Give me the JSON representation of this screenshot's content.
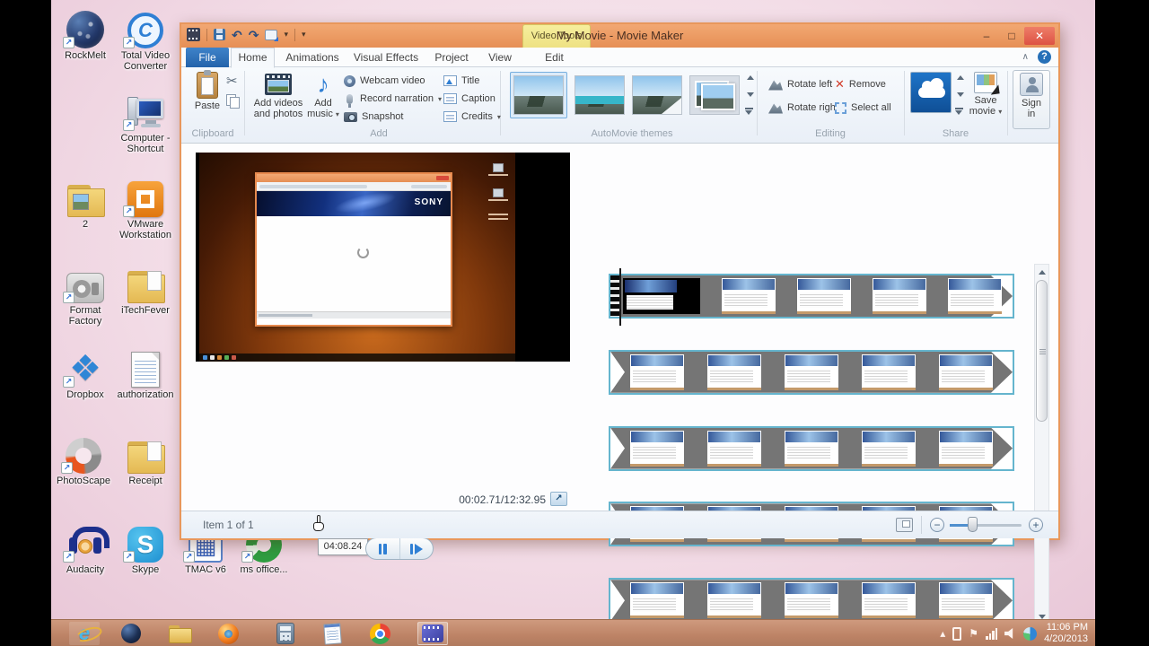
{
  "glyphs": {
    "minimize": "–",
    "maximize": "□",
    "close": "✕",
    "help": "?",
    "collapse_ribbon": "∧",
    "undo": "↶",
    "redo": "↷",
    "dropdown": "▾",
    "scissors": "✂",
    "music_note": "♪",
    "fullscreen": "↗",
    "zoom_out": "−",
    "zoom_in": "+",
    "tray_up": "▴",
    "tray_flag": "⚑",
    "dropbox_icon": "❖",
    "skype_s": "S",
    "tvc_c": "C",
    "ie_e": "e",
    "tmac_grid": "▦",
    "remove_x": "✕"
  },
  "window": {
    "title": "My Movie - Movie Maker",
    "contextual_tab_label": "Video Tools",
    "tabs": [
      "File",
      "Home",
      "Animations",
      "Visual Effects",
      "Project",
      "View",
      "Edit"
    ],
    "active_tab": "Home"
  },
  "ribbon": {
    "clipboard": {
      "label": "Clipboard",
      "paste": "Paste"
    },
    "add": {
      "label": "Add",
      "add_videos_l1": "Add videos",
      "add_videos_l2": "and photos",
      "add_music_l1": "Add",
      "add_music_l2": "music",
      "webcam": "Webcam video",
      "narration": "Record narration",
      "snapshot": "Snapshot",
      "title": "Title",
      "caption": "Caption",
      "credits": "Credits"
    },
    "automovie": {
      "label": "AutoMovie themes"
    },
    "editing": {
      "label": "Editing",
      "rotate_left": "Rotate left",
      "rotate_right": "Rotate right",
      "remove": "Remove",
      "select_all": "Select all"
    },
    "share": {
      "label": "Share",
      "save_l1": "Save",
      "save_l2": "movie"
    },
    "sign_in_l1": "Sign",
    "sign_in_l2": "in"
  },
  "preview": {
    "timestamp": "00:02.71/12:32.95",
    "seek_tooltip": "04:08.24",
    "video_banner_text": "SONY"
  },
  "storyboard": {
    "row_count": 5,
    "clips_per_row": 5
  },
  "statusbar": {
    "item_count": "Item 1 of 1"
  },
  "desktop": {
    "icons": [
      {
        "name": "rockmelt",
        "label": "RockMelt"
      },
      {
        "name": "total-video-converter",
        "label": "Total Video Converter"
      },
      {
        "name": "computer-shortcut",
        "label": "Computer - Shortcut"
      },
      {
        "name": "folder-2",
        "label": "2"
      },
      {
        "name": "vmware-workstation",
        "label": "VMware Workstation"
      },
      {
        "name": "format-factory",
        "label": "Format Factory"
      },
      {
        "name": "itechfever",
        "label": "iTechFever"
      },
      {
        "name": "dropbox",
        "label": "Dropbox"
      },
      {
        "name": "authorization",
        "label": "authorization"
      },
      {
        "name": "photoscape",
        "label": "PhotoScape"
      },
      {
        "name": "receipt",
        "label": "Receipt"
      },
      {
        "name": "audacity",
        "label": "Audacity"
      },
      {
        "name": "skype",
        "label": "Skype"
      },
      {
        "name": "tmac-v6",
        "label": "TMAC v6"
      },
      {
        "name": "ms-office",
        "label": "ms office..."
      }
    ]
  },
  "taskbar": {
    "items": [
      "internet-explorer",
      "rockmelt",
      "file-explorer",
      "firefox",
      "calculator",
      "notepad",
      "chrome",
      "movie-maker"
    ],
    "tray_time": "11:06 PM",
    "tray_date": "4/20/2013"
  }
}
